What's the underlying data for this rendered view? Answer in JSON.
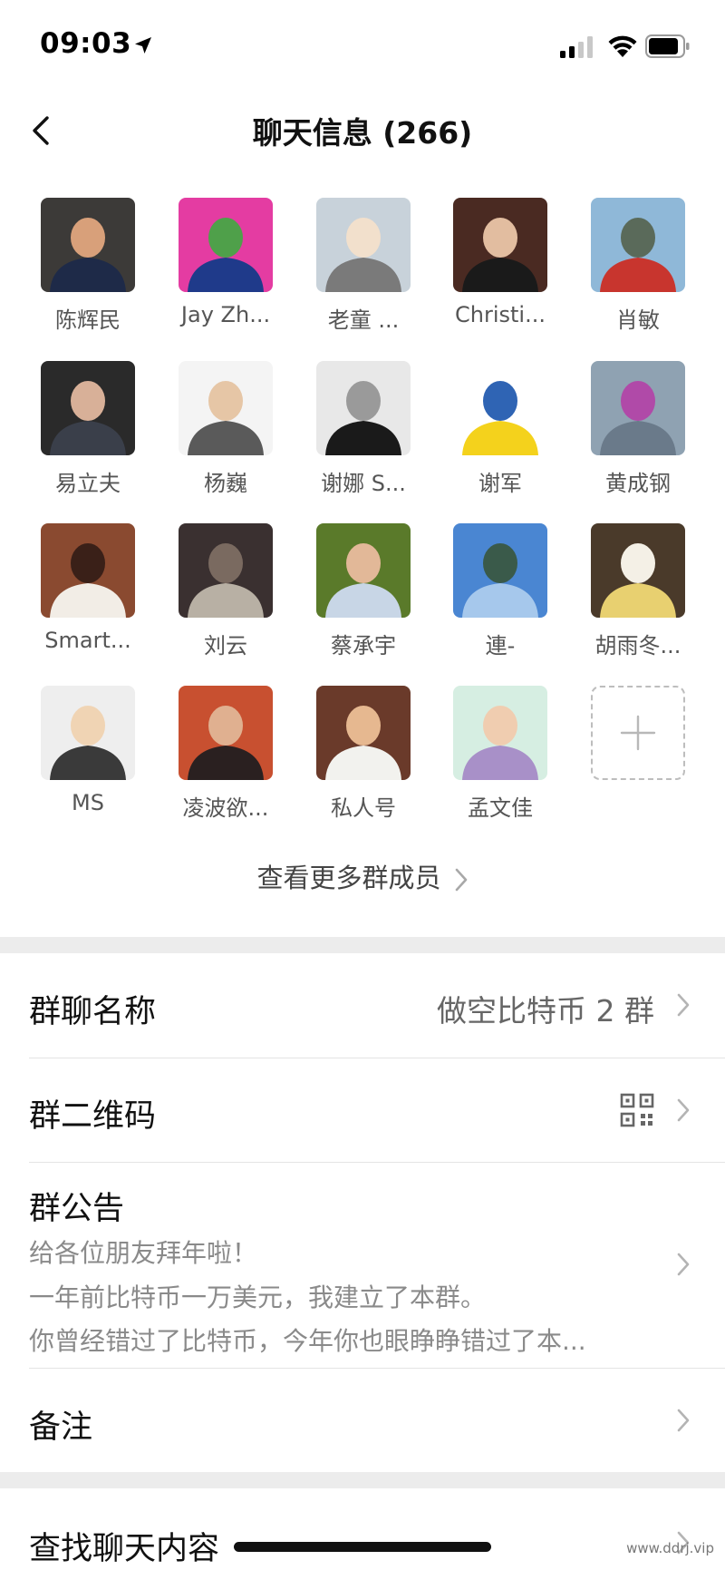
{
  "status": {
    "time": "09:03"
  },
  "header": {
    "title": "聊天信息 (266)"
  },
  "members": [
    {
      "name": "陈辉民",
      "avatar": "photo-man-dark-shirt",
      "colors": [
        "#3c3a38",
        "#1e2a48",
        "#d8a07a"
      ]
    },
    {
      "name": "Jay Zh...",
      "avatar": "cartoon-bear-pink",
      "colors": [
        "#e43ca2",
        "#1f3a8a",
        "#4fa04a"
      ]
    },
    {
      "name": "老童 ...",
      "avatar": "drawing-grey-hair",
      "colors": [
        "#c8d2da",
        "#7a7a7a",
        "#f2e0cc"
      ]
    },
    {
      "name": "Christi...",
      "avatar": "photo-man-peace-sign",
      "colors": [
        "#4a2a22",
        "#1a1a1a",
        "#e2bda0"
      ]
    },
    {
      "name": "肖敏",
      "avatar": "photo-lake-red-jacket",
      "colors": [
        "#8fb8d8",
        "#c8352e",
        "#5a6a5a"
      ]
    },
    {
      "name": "易立夫",
      "avatar": "photo-man-suit",
      "colors": [
        "#2a2a2a",
        "#3a3f4a",
        "#d8b098"
      ]
    },
    {
      "name": "杨巍",
      "avatar": "pixel-man",
      "colors": [
        "#f4f4f4",
        "#5a5a5a",
        "#e6c6a6"
      ]
    },
    {
      "name": "谢娜 S...",
      "avatar": "comic-woman-bw",
      "colors": [
        "#e8e8e8",
        "#1a1a1a",
        "#9a9a9a"
      ]
    },
    {
      "name": "谢军",
      "avatar": "minion",
      "colors": [
        "#ffffff",
        "#f4d21c",
        "#2f64b4"
      ]
    },
    {
      "name": "黄成钢",
      "avatar": "photo-kayak",
      "colors": [
        "#8fa2b2",
        "#6a7a8a",
        "#b04aa8"
      ]
    },
    {
      "name": "Smart...",
      "avatar": "photo-white-poodle",
      "colors": [
        "#8a4a30",
        "#f2ede6",
        "#3a2018"
      ]
    },
    {
      "name": "刘云",
      "avatar": "photo-stone-wall",
      "colors": [
        "#3a3030",
        "#b8b0a4",
        "#7a6a60"
      ]
    },
    {
      "name": "蔡承宇",
      "avatar": "photo-man-flowers",
      "colors": [
        "#5a7a2a",
        "#c8d6e6",
        "#e2b898"
      ]
    },
    {
      "name": "連-",
      "avatar": "photo-mountains-sky",
      "colors": [
        "#4a86d2",
        "#a6c8ec",
        "#3a5a4a"
      ]
    },
    {
      "name": "胡雨冬...",
      "avatar": "photo-woman-flowers",
      "colors": [
        "#4a3a2a",
        "#e8d070",
        "#f4f0e6"
      ]
    },
    {
      "name": "MS",
      "avatar": "cartoon-mustache-man",
      "colors": [
        "#eeeeee",
        "#3a3a3a",
        "#f0d4b4"
      ]
    },
    {
      "name": "凌波欲...",
      "avatar": "photo-man-red-bg",
      "colors": [
        "#c85030",
        "#2a2020",
        "#e0b090"
      ]
    },
    {
      "name": "私人号",
      "avatar": "photo-boy-cup",
      "colors": [
        "#6a3a2a",
        "#f2f2ee",
        "#e6b890"
      ]
    },
    {
      "name": "孟文佳",
      "avatar": "cartoon-little-monk",
      "colors": [
        "#d6eee2",
        "#a890c8",
        "#f0cdb0"
      ]
    }
  ],
  "add_member": {
    "icon": "plus-icon"
  },
  "more_members": {
    "label": "查看更多群成员"
  },
  "rows": {
    "group_name": {
      "label": "群聊名称",
      "value": "做空比特币 2 群"
    },
    "qr_code": {
      "label": "群二维码",
      "icon": "qr-code-icon"
    },
    "notice": {
      "label": "群公告",
      "lines": [
        "给各位朋友拜年啦！",
        "一年前比特币一万美元，我建立了本群。",
        "你曾经错过了比特币，今年你也眼睁睁错过了本..."
      ]
    },
    "remark": {
      "label": "备注"
    },
    "search": {
      "label": "查找聊天内容"
    }
  },
  "watermark": "www.ddrj.vip",
  "colors": {
    "separator": "#ececec",
    "secondary_text": "#8a8a8a",
    "chevron": "#b4b4b4"
  }
}
